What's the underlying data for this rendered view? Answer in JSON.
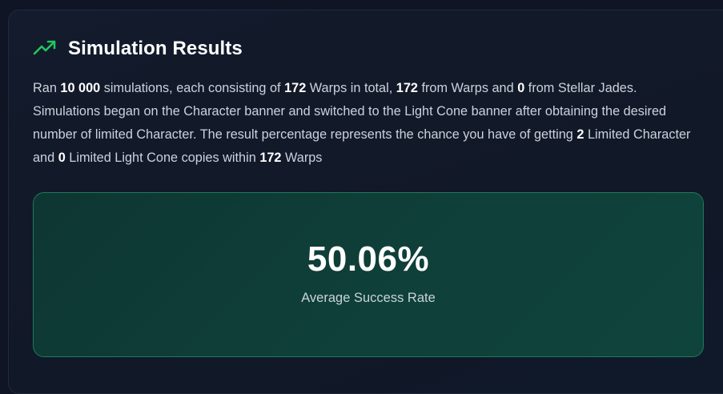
{
  "header": {
    "icon": "trending-up-icon",
    "title": "Simulation Results"
  },
  "description": {
    "t1": "Ran ",
    "simulations": "10 000",
    "t2": " simulations, each consisting of ",
    "total_warps": "172",
    "t3": " Warps in total, ",
    "warps_from_warps": "172",
    "t4": " from Warps and ",
    "warps_from_jades": "0",
    "t5": " from Stellar Jades. Simulations began on the Character banner and switched to the Light Cone banner after obtaining the desired number of limited Character. The result percentage represents the chance you have of getting ",
    "limited_character": "2",
    "t6": " Limited Character and ",
    "limited_light_cone": "0",
    "t7": " Limited Light Cone copies within ",
    "within_warps": "172",
    "t8": " Warps"
  },
  "result": {
    "rate": "50.06%",
    "label": "Average Success Rate"
  },
  "colors": {
    "accent_green": "#22c55e",
    "result_bg": "#0f3f39",
    "result_border": "#1e7a5a"
  }
}
